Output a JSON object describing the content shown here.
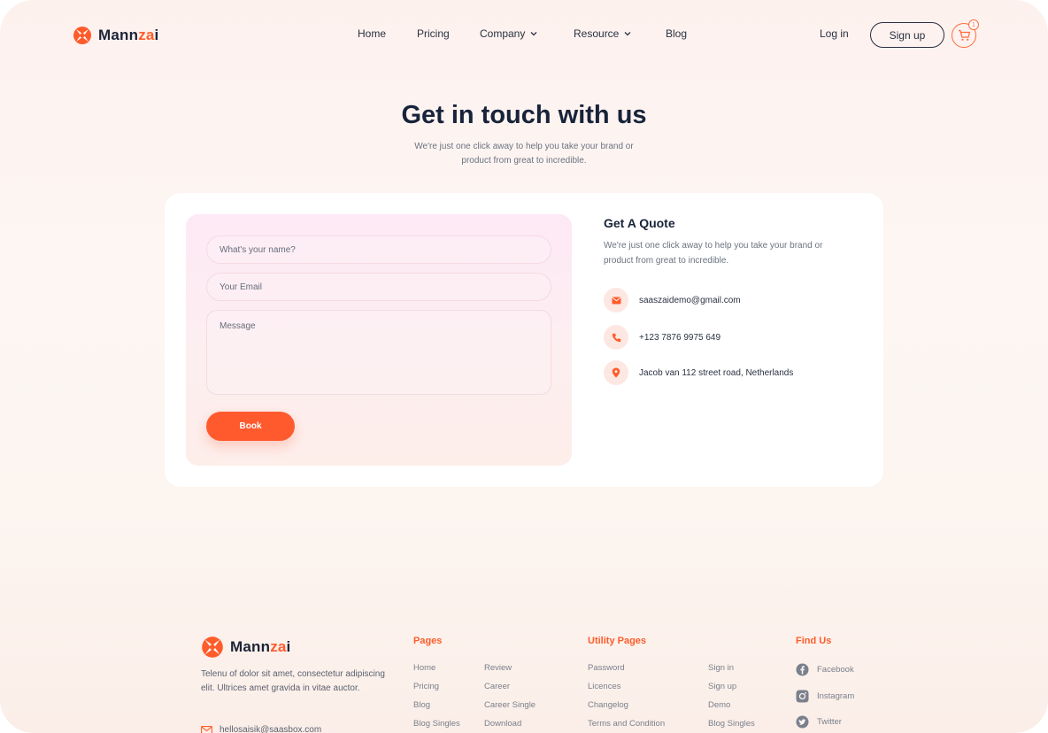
{
  "brand": {
    "name_main": "Mann",
    "name_accent": "za",
    "name_end": "i",
    "accent_color": "#ff5c2b"
  },
  "nav": {
    "items": [
      {
        "label": "Home",
        "dropdown": false
      },
      {
        "label": "Pricing",
        "dropdown": false
      },
      {
        "label": "Company",
        "dropdown": true
      },
      {
        "label": "Resource",
        "dropdown": true
      },
      {
        "label": "Blog",
        "dropdown": false
      }
    ],
    "login": "Log in",
    "signup": "Sign up",
    "cart_count": "1"
  },
  "hero": {
    "title": "Get in touch with us",
    "subtitle": "We're just one click away to help you take your brand or product from great to incredible."
  },
  "form": {
    "name_placeholder": "What's your name?",
    "email_placeholder": "Your Email",
    "message_placeholder": "Message",
    "submit_label": "Book"
  },
  "quote": {
    "title": "Get A Quote",
    "subtitle": "We're just one click away to help you take your brand or product from great to incredible.",
    "email": "saaszaidemo@gmail.com",
    "phone": "+123 7876 9975 649",
    "address": "Jacob van 112 street road, Netherlands"
  },
  "footer": {
    "description": "Telenu of dolor sit amet, consectetur adipiscing elit. Ultrices amet gravida in vitae auctor.",
    "email": "hellosaisik@saasbox.com",
    "pages_title": "Pages",
    "pages_col1": [
      "Home",
      "Pricing",
      "Blog",
      "Blog Singles"
    ],
    "pages_col2": [
      "Review",
      "Career",
      "Career Single",
      "Download"
    ],
    "utility_title": "Utility Pages",
    "utility_col1": [
      "Password",
      "Licences",
      "Changelog",
      "Terms and Condition"
    ],
    "utility_col2": [
      "Sign in",
      "Sign up",
      "Demo",
      "Blog Singles"
    ],
    "find_title": "Find Us",
    "social": [
      "Facebook",
      "Instagram",
      "Twitter"
    ]
  }
}
